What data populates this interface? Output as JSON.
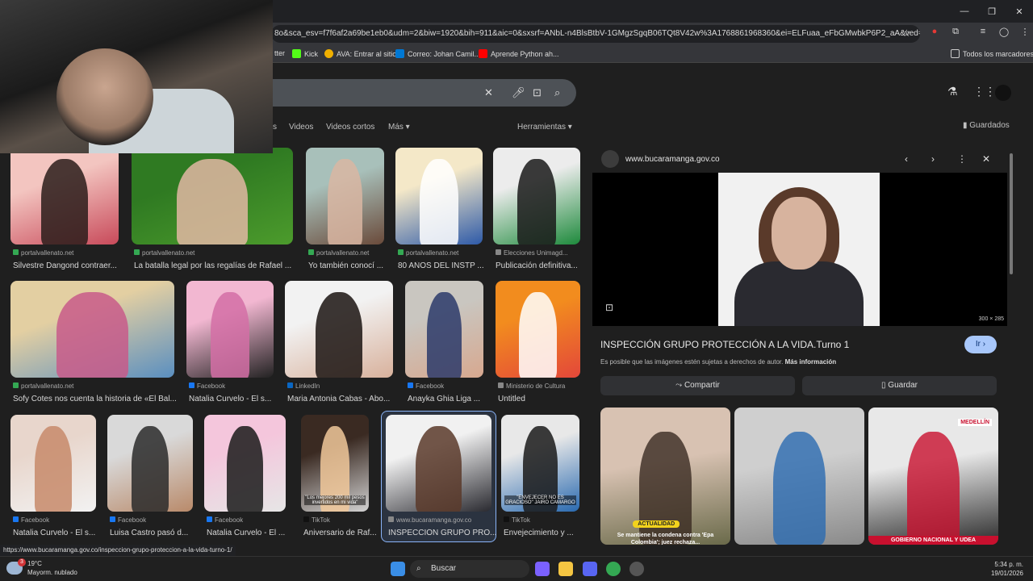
{
  "browser": {
    "url": "8o&sca_esv=f7f6af2a69be1eb0&udm=2&biw=1920&bih=911&aic=0&sxsrf=ANbL-n4BlsBtbV-1GMgzSgqB06TQt8V42w%3A1768861968360&ei=ELFuaa_eFbGMwbkP6P2_aA&ved=0ah...",
    "window_controls": [
      "—",
      "❐",
      "✕"
    ],
    "bookmarks": [
      {
        "label": "tter",
        "color": "#1d9bf0"
      },
      {
        "label": "Kick",
        "color": "#53fc18"
      },
      {
        "label": "AVA: Entrar al sitio",
        "color": "#f0b000"
      },
      {
        "label": "Correo: Johan Camil...",
        "color": "#0078d4"
      },
      {
        "label": "Aprende Python ah...",
        "color": "#ff0000"
      }
    ],
    "all_bookmarks": "Todos los marcadores",
    "status_url": "https://www.bucaramanga.gov.co/inspeccion-grupo-proteccion-a-la-vida-turno-1/"
  },
  "search": {
    "tabs": [
      "s",
      "Videos",
      "Videos cortos",
      "Más ▾"
    ],
    "tools": "Herramientas ▾",
    "saved": "Guardados"
  },
  "results": [
    {
      "source": "portalvallenato.net",
      "title": "Silvestre Dangond contraer...",
      "src_color": "#34a853",
      "colors": [
        "#f3c5c0",
        "#2a1c1a",
        "#c84a5a"
      ]
    },
    {
      "source": "portalvallenato.net",
      "title": "La batalla legal por las regalías de Rafael ...",
      "src_color": "#34a853",
      "colors": [
        "#2f7a22",
        "#e2b7a3",
        "#4c9b2c"
      ]
    },
    {
      "source": "portalvallenato.net",
      "title": "Yo también conocí ...",
      "src_color": "#34a853",
      "colors": [
        "#a8c0ba",
        "#d9b6a2",
        "#6a4a3a"
      ]
    },
    {
      "source": "portalvallenato.net",
      "title": "80 AÑOS DEL INSTP ...",
      "src_color": "#34a853",
      "colors": [
        "#f4e8c8",
        "#ffffff",
        "#2e5aa8"
      ]
    },
    {
      "source": "Elecciones Unimagd...",
      "title": "Publicación definitiva...",
      "src_color": "#888",
      "colors": [
        "#ececec",
        "#1a1a1a",
        "#1e8a3c"
      ]
    },
    {
      "source": "portalvallenato.net",
      "title": "Sofy Cotes nos cuenta la historia de «El Bal...",
      "src_color": "#34a853",
      "colors": [
        "#e3cfa2",
        "#c85a8a",
        "#5a8fc0"
      ]
    },
    {
      "source": "Facebook",
      "title": "Natalia Curvelo - El s...",
      "src_color": "#1877f2",
      "colors": [
        "#f2b7d1",
        "#d36fa6",
        "#222"
      ]
    },
    {
      "source": "LinkedIn",
      "title": "Maria Antonia Cabas - Abo...",
      "src_color": "#0a66c2",
      "colors": [
        "#f2f2f2",
        "#1b1412",
        "#d8b19c"
      ]
    },
    {
      "source": "Facebook",
      "title": "Anayka Ghia Liga ...",
      "src_color": "#1877f2",
      "colors": [
        "#c9c6c0",
        "#2c3a6a",
        "#d7a88f"
      ]
    },
    {
      "source": "Ministerio de Cultura",
      "title": "Untitled",
      "src_color": "#888",
      "colors": [
        "#f28c1e",
        "#ffffff",
        "#e3473a"
      ]
    },
    {
      "source": "Facebook",
      "title": "Natalia Curvelo - El s...",
      "src_color": "#1877f2",
      "colors": [
        "#e8d6cc",
        "#c78a6a",
        "#f2f2f2"
      ]
    },
    {
      "source": "Facebook",
      "title": "Luisa Castro pasó d...",
      "src_color": "#1877f2",
      "colors": [
        "#d9d9d9",
        "#2a2a2a",
        "#b98a6a"
      ]
    },
    {
      "source": "Facebook",
      "title": "Natalia Curvelo - El ...",
      "src_color": "#1877f2",
      "colors": [
        "#f4c6dc",
        "#1a1a1a",
        "#e6e6e6"
      ]
    },
    {
      "source": "TikTok",
      "title": "Aniversario de Raf...",
      "src_color": "#111",
      "colors": [
        "#3a2a22",
        "#f1c89a",
        "#d2d2d2"
      ],
      "caption": "\"Los mejores 200 mil pesos invertidos en mi vida\""
    },
    {
      "source": "www.bucaramanga.gov.co",
      "title": "INSPECCIÓN GRUPO PRO...",
      "src_color": "#888",
      "colors": [
        "#f1f1f1",
        "#5a3a2a",
        "#2a2a30"
      ]
    },
    {
      "source": "TikTok",
      "title": "Envejecimiento y ...",
      "src_color": "#111",
      "colors": [
        "#e8e8e8",
        "#1a1a1a",
        "#2a6ab0"
      ],
      "caption": "\"ENVEJECER NO ES GRACIOSO\" JAIRO CAMARGO"
    }
  ],
  "panel": {
    "site": "www.bucaramanga.gov.co",
    "dims": "300 × 285",
    "title": "INSPECCIÓN GRUPO PROTECCIÓN A LA VIDA.Turno 1",
    "go": "Ir ›",
    "note": "Es posible que las imágenes estén sujetas a derechos de autor.",
    "more_info": "Más información",
    "share": "Compartir",
    "save": "Guardar",
    "related": [
      {
        "colors": [
          "#d8c2b2",
          "#3a2a22",
          "#6a6a4a"
        ],
        "caption": "ACTUALIDAD",
        "sub": "Se mantiene la condena contra 'Epa Colombia'; juez rechaza..."
      },
      {
        "colors": [
          "#cfcfcf",
          "#2a6ab0",
          "#8a8a8a"
        ],
        "caption": "",
        "sub": ""
      },
      {
        "colors": [
          "#e8e8e8",
          "#c8102e",
          "#2a2a2a"
        ],
        "caption": "MEDELLÍN",
        "sub": "GOBIERNO NACIONAL Y UDEA"
      }
    ]
  },
  "taskbar": {
    "temp": "19°C",
    "weather": "Mayorm. nublado",
    "badge": "3",
    "search": "Buscar",
    "time": "5:34 p. m.",
    "date": "19/01/2026"
  }
}
